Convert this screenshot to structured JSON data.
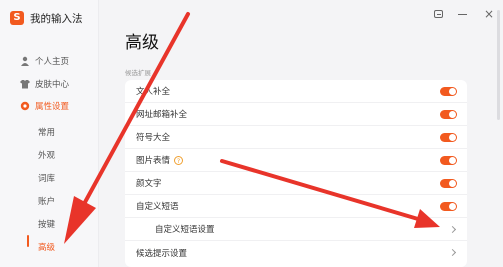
{
  "app": {
    "title": "我的输入法",
    "logo_letter": "S"
  },
  "sidebar": {
    "items": [
      {
        "label": "个人主页",
        "icon": "person-icon"
      },
      {
        "label": "皮肤中心",
        "icon": "shirt-icon"
      },
      {
        "label": "属性设置",
        "icon": "gear-icon"
      }
    ],
    "sub_items": [
      {
        "label": "常用"
      },
      {
        "label": "外观"
      },
      {
        "label": "词库"
      },
      {
        "label": "账户"
      },
      {
        "label": "按键"
      },
      {
        "label": "高级"
      }
    ]
  },
  "window": {
    "menu_icon": "menu-icon",
    "minimize_icon": "minimize-icon",
    "close_glyph": "×"
  },
  "main": {
    "title": "高级",
    "section_label": "候选扩展",
    "rows": [
      {
        "label": "文人补全",
        "control": "toggle",
        "on": true
      },
      {
        "label": "网址邮箱补全",
        "control": "toggle",
        "on": true
      },
      {
        "label": "符号大全",
        "control": "toggle",
        "on": true
      },
      {
        "label": "图片表情",
        "control": "toggle",
        "on": true,
        "help": "?"
      },
      {
        "label": "颜文字",
        "control": "toggle",
        "on": true
      },
      {
        "label": "自定义短语",
        "control": "toggle",
        "on": true
      },
      {
        "label": "自定义短语设置",
        "control": "chevron"
      },
      {
        "label": "候选提示设置",
        "control": "chevron"
      }
    ]
  },
  "colors": {
    "accent": "#f25a1f",
    "annotation_arrow": "#e8342a"
  }
}
